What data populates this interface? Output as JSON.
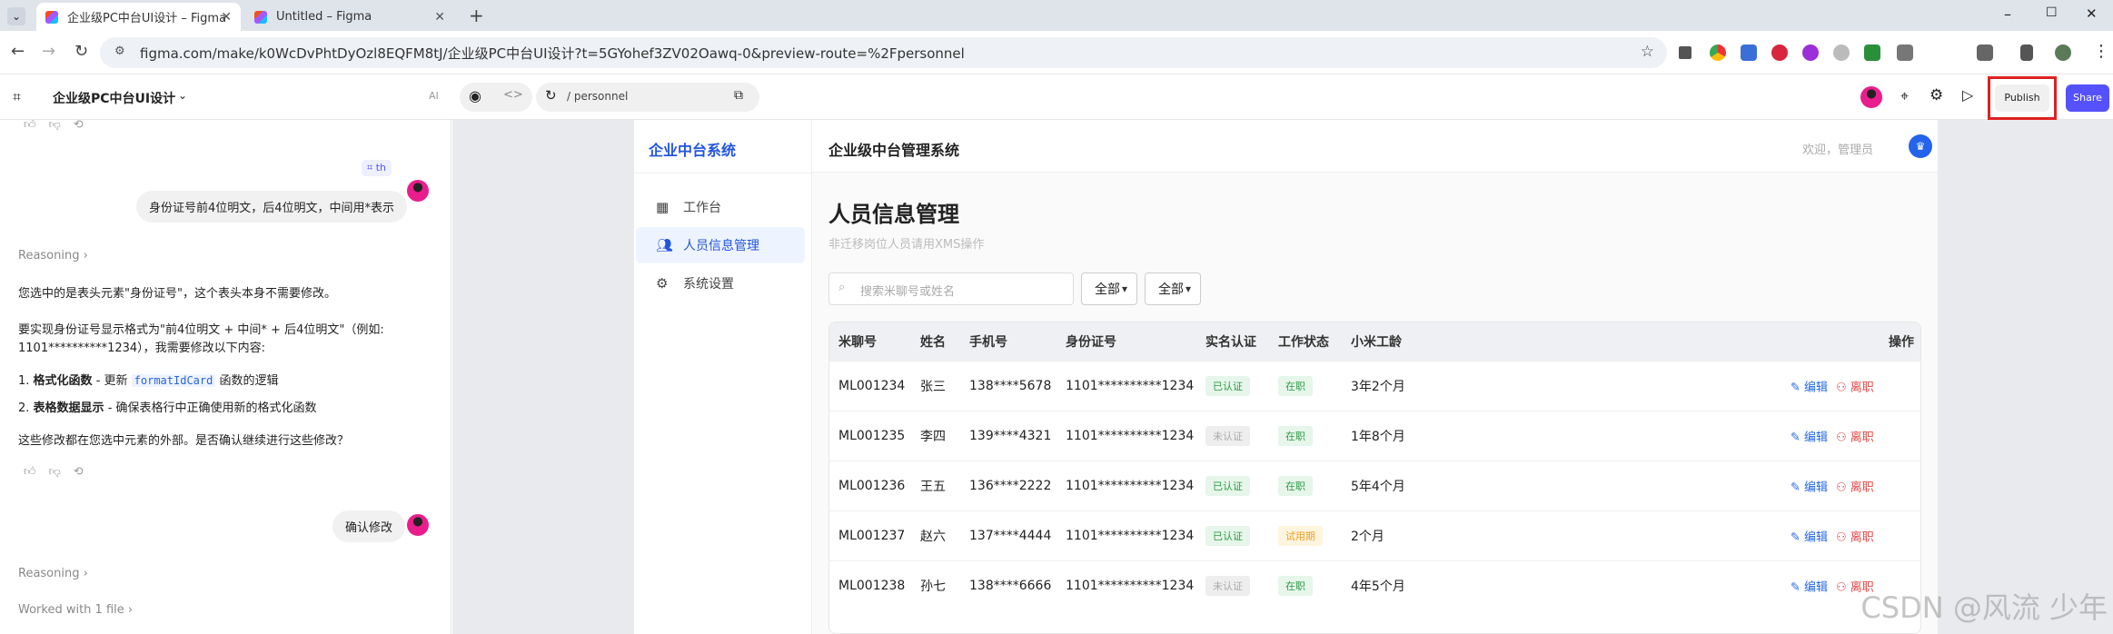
{
  "browser": {
    "tabs": [
      {
        "label": "企业级PC中台UI设计 – Figma"
      },
      {
        "label": "Untitled – Figma"
      }
    ],
    "new_tab": "+",
    "url": "figma.com/make/k0WcDvPhtDyOzl8EQFM8tJ/企业级PC中台UI设计?t=5GYohef3ZV02Oawq-0&preview-route=%2Fpersonnel"
  },
  "app": {
    "project_title": "企业级PC中台UI设计",
    "ai_label": "AI",
    "route": "/ personnel",
    "publish": "Publish",
    "share": "Share"
  },
  "chat": {
    "user_tag": "th",
    "user_msg1": "身份证号前4位明文，后4位明文，中间用*表示",
    "reasoning": "Reasoning",
    "para1": "您选中的是表头元素\"身份证号\"，这个表头本身不需要修改。",
    "para2a": "要实现身份证号显示格式为\"前4位明文 + 中间* + 后4位明文\"（例如:",
    "para2b": "1101**********1234），我需要修改以下内容:",
    "li1_num": "1.",
    "li1_bold": "格式化函数",
    "li1_mid": " - 更新 ",
    "li1_code": "formatIdCard",
    "li1_end": " 函数的逻辑",
    "li2_num": "2.",
    "li2_bold": "表格数据显示",
    "li2_end": " - 确保表格行中正确使用新的格式化函数",
    "para3": "这些修改都在您选中元素的外部。是否确认继续进行这些修改？",
    "user_msg2": "确认修改",
    "reasoning2": "Reasoning",
    "worked": "Worked with 1 file"
  },
  "site": {
    "brand": "企业中台系统",
    "header_title": "企业级中台管理系统",
    "welcome": "欢迎，管理员",
    "menu": [
      {
        "label": "工作台",
        "icon": "dashboard-icon"
      },
      {
        "label": "人员信息管理",
        "icon": "users-icon"
      },
      {
        "label": "系统设置",
        "icon": "gear-icon"
      }
    ],
    "page_title": "人员信息管理",
    "page_sub": "非迁移岗位人员请用XMS操作",
    "search_placeholder": "搜索米聊号或姓名",
    "filter1": "全部",
    "filter2": "全部"
  },
  "table": {
    "headers": [
      "米聊号",
      "姓名",
      "手机号",
      "身份证号",
      "实名认证",
      "工作状态",
      "小米工龄",
      "操作"
    ],
    "rows": [
      {
        "id": "ML001234",
        "name": "张三",
        "phone": "138****5678",
        "idno": "1101**********1234",
        "auth": "已认证",
        "auth_type": "green",
        "status": "在职",
        "status_type": "green",
        "tenure": "3年2个月"
      },
      {
        "id": "ML001235",
        "name": "李四",
        "phone": "139****4321",
        "idno": "1101**********1234",
        "auth": "未认证",
        "auth_type": "gray",
        "status": "在职",
        "status_type": "green",
        "tenure": "1年8个月"
      },
      {
        "id": "ML001236",
        "name": "王五",
        "phone": "136****2222",
        "idno": "1101**********1234",
        "auth": "已认证",
        "auth_type": "green",
        "status": "在职",
        "status_type": "green",
        "tenure": "5年4个月"
      },
      {
        "id": "ML001237",
        "name": "赵六",
        "phone": "137****4444",
        "idno": "1101**********1234",
        "auth": "已认证",
        "auth_type": "green",
        "status": "试用期",
        "status_type": "orange",
        "tenure": "2个月"
      },
      {
        "id": "ML001238",
        "name": "孙七",
        "phone": "138****6666",
        "idno": "1101**********1234",
        "auth": "未认证",
        "auth_type": "gray",
        "status": "在职",
        "status_type": "green",
        "tenure": "4年5个月"
      }
    ],
    "edit": "编辑",
    "leave": "离职"
  },
  "watermark": "CSDN @风流 少年"
}
